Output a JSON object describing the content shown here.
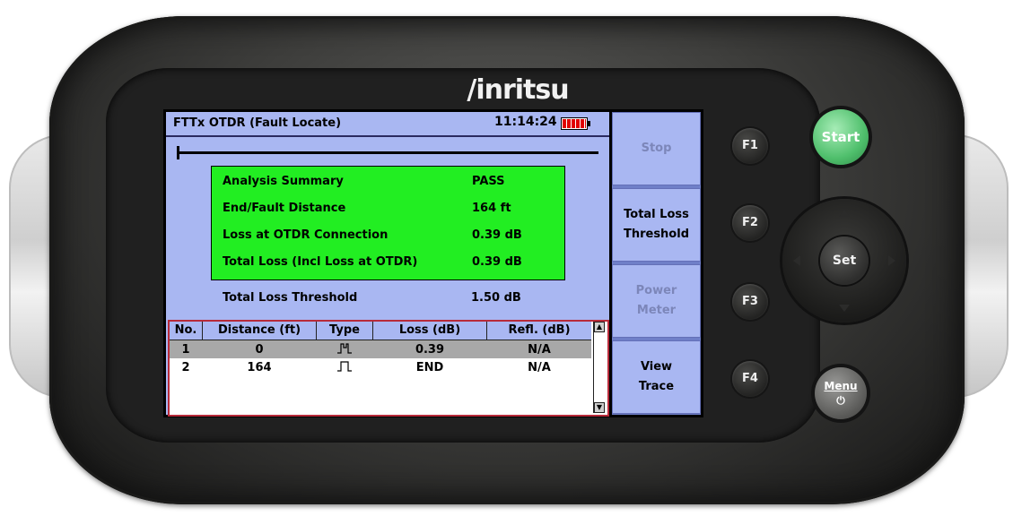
{
  "brand": "/inritsu",
  "screen": {
    "title": "FTTx OTDR (Fault Locate)",
    "clock": "11:14:24",
    "summary": {
      "rows": [
        {
          "label": "Analysis Summary",
          "value": "PASS"
        },
        {
          "label": "End/Fault Distance",
          "value": "164 ft"
        },
        {
          "label": "Loss at OTDR Connection",
          "value": "0.39 dB"
        },
        {
          "label": "Total Loss (Incl Loss at OTDR)",
          "value": "0.39 dB"
        }
      ],
      "threshold_label": "Total Loss Threshold",
      "threshold_value": "1.50 dB"
    },
    "events": {
      "headers": [
        "No.",
        "Distance (ft)",
        "Type",
        "Loss (dB)",
        "Refl. (dB)"
      ],
      "rows": [
        {
          "no": "1",
          "distance": "0",
          "loss": "0.39",
          "refl": "N/A",
          "selected": true
        },
        {
          "no": "2",
          "distance": "164",
          "loss": "END",
          "refl": "N/A",
          "selected": false
        }
      ]
    }
  },
  "softkeys": [
    {
      "line1": "Stop",
      "line2": "",
      "enabled": false
    },
    {
      "line1": "Total Loss",
      "line2": "Threshold",
      "enabled": true
    },
    {
      "line1": "Power",
      "line2": "Meter",
      "enabled": false
    },
    {
      "line1": "View",
      "line2": "Trace",
      "enabled": true
    }
  ],
  "hardware": {
    "f_keys": [
      "F1",
      "F2",
      "F3",
      "F4"
    ],
    "start": "Start",
    "set": "Set",
    "menu": "Menu",
    "power_symbol": "⏻"
  },
  "colors": {
    "lcd_background": "#a9b7f2",
    "summary_pass_green": "#22ee22",
    "battery_red": "#e00000",
    "start_green": "#4fbf6c"
  }
}
